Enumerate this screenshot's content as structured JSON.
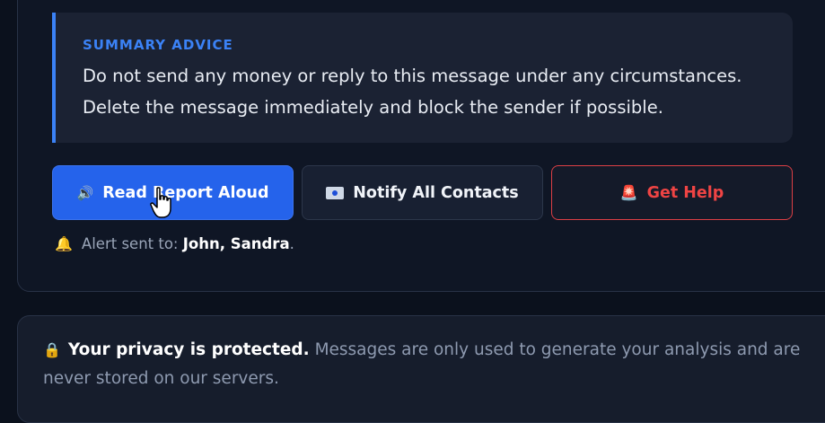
{
  "summary": {
    "title": "SUMMARY ADVICE",
    "line1": "Do not send any money or reply to this message under any circumstances.",
    "line2": "Delete the message immediately and block the sender if possible.",
    "accent_color": "#3b82f6"
  },
  "actions": {
    "read_label": "Read Report Aloud",
    "read_icon": "speaker-icon",
    "notify_label": "Notify All Contacts",
    "notify_icon": "mail-icon",
    "help_label": "Get Help",
    "help_icon": "siren-icon",
    "primary_color": "#2563eb",
    "danger_color": "#ef4444"
  },
  "alert": {
    "icon": "bell-icon",
    "prefix": "Alert sent to:",
    "names": "John, Sandra",
    "suffix": "."
  },
  "privacy": {
    "icon": "lock-icon",
    "strong": "Your privacy is protected.",
    "rest1": "Messages are only used to generate your analysis and are",
    "rest2": "never stored on our servers."
  }
}
